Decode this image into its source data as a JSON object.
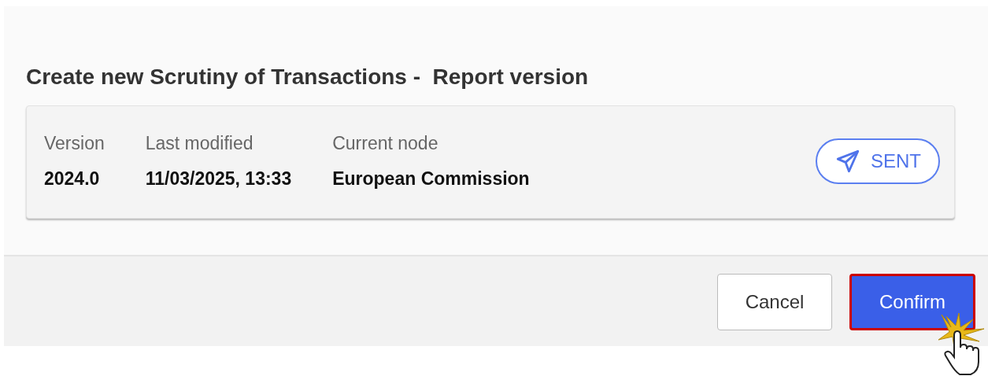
{
  "dialog": {
    "title": "Create new Scrutiny of Transactions -  Report version",
    "fields": [
      {
        "label": "Version",
        "value": "2024.0"
      },
      {
        "label": "Last modified",
        "value": "11/03/2025, 13:33"
      },
      {
        "label": "Current node",
        "value": "European Commission"
      }
    ],
    "status": {
      "label": "SENT"
    },
    "buttons": [
      {
        "label": "Cancel",
        "kind": "secondary",
        "highlighted": false
      },
      {
        "label": "Confirm",
        "kind": "primary",
        "highlighted": true
      }
    ]
  }
}
